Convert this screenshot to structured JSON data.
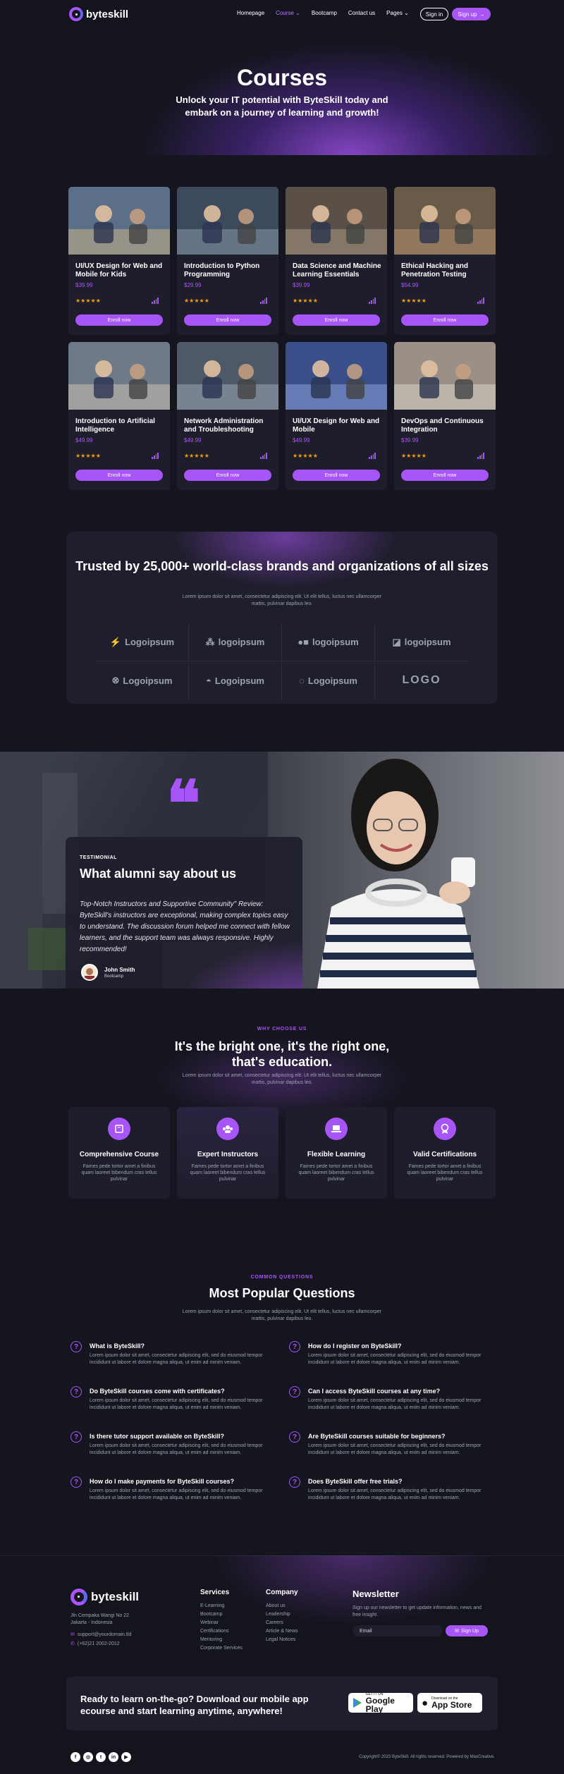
{
  "header": {
    "logo": "byteskill",
    "nav": [
      {
        "label": "Homepage",
        "active": false,
        "dropdown": false
      },
      {
        "label": "Course",
        "active": true,
        "dropdown": true
      },
      {
        "label": "Bootcamp",
        "active": false,
        "dropdown": false
      },
      {
        "label": "Contact us",
        "active": false,
        "dropdown": false
      },
      {
        "label": "Pages",
        "active": false,
        "dropdown": true
      }
    ],
    "signin": "Sign in",
    "signup": "Sign up"
  },
  "hero": {
    "title": "Courses",
    "subtitle": "Unlock your IT potential with ByteSkill today and embark on a journey of learning and growth!"
  },
  "courses": [
    {
      "title": "UI/UX Design for Web and Mobile for Kids",
      "price": "$39.99",
      "stars": "★★★★★",
      "button": "Enroll now"
    },
    {
      "title": "Introduction to Python Programming",
      "price": "$29.99",
      "stars": "★★★★★",
      "button": "Enroll now"
    },
    {
      "title": "Data Science and Machine Learning Essentials",
      "price": "$39.99",
      "stars": "★★★★★",
      "button": "Enroll now"
    },
    {
      "title": "Ethical Hacking and Penetration Testing",
      "price": "$54.99",
      "stars": "★★★★★",
      "button": "Enroll now"
    },
    {
      "title": "Introduction to Artificial Intelligence",
      "price": "$49.99",
      "stars": "★★★★★",
      "button": "Enroll now"
    },
    {
      "title": "Network Administration and Troubleshooting",
      "price": "$49.99",
      "stars": "★★★★★",
      "button": "Enroll now"
    },
    {
      "title": "UI/UX Design for Web and Mobile",
      "price": "$49.99",
      "stars": "★★★★★",
      "button": "Enroll now"
    },
    {
      "title": "DevOps and Continuous Integration",
      "price": "$39.99",
      "stars": "★★★★★",
      "button": "Enroll now"
    }
  ],
  "trusted": {
    "title": "Trusted by 25,000+ world-class brands and organizations of all sizes",
    "text": "Lorem ipsum dolor sit amet, consectetur adipiscing elit. Ut elit tellus, luctus nec ullamcorper mattis, pulvinar dapibus leo.",
    "logos": [
      "Logoipsum",
      "logoipsum",
      "logoipsum",
      "logoipsum",
      "Logoipsum",
      "Logoipsum",
      "Logoipsum",
      "LOGO"
    ]
  },
  "testimonial": {
    "label": "TESTIMONIAL",
    "title": "What alumni say about us",
    "text": "Top-Notch Instructors and Supportive Community\" Review: ByteSkill's instructors are exceptional, making complex topics easy to understand. The discussion forum helped me connect with fellow learners, and the support team was always responsive. Highly recommended!",
    "name": "John Smith",
    "role": "Bootcamp"
  },
  "why": {
    "label": "WHY CHOOSE US",
    "title": "It's the bright one, it's the right one, that's education.",
    "text": "Lorem ipsum dolor sit amet, consectetur adipiscing elit. Ut elit tellus, luctus nec ullamcorper mattis, pulvinar dapibus leo.",
    "features": [
      {
        "title": "Comprehensive Course",
        "text": "Fames pede tortor amet a finibus quam laoreet bibendum cras tellus pulvinar"
      },
      {
        "title": "Expert Instructors",
        "text": "Fames pede tortor amet a finibus quam laoreet bibendum cras tellus pulvinar"
      },
      {
        "title": "Flexible Learning",
        "text": "Fames pede tortor amet a finibus quam laoreet bibendum cras tellus pulvinar"
      },
      {
        "title": "Valid Certifications",
        "text": "Fames pede tortor amet a finibus quam laoreet bibendum cras tellus pulvinar"
      }
    ]
  },
  "faq": {
    "label": "COMMON QUESTIONS",
    "title": "Most Popular Questions",
    "text": "Lorem ipsum dolor sit amet, consectetur adipiscing elit. Ut elit tellus, luctus nec ullamcorper mattis, pulvinar dapibus leo.",
    "answer": "Lorem ipsum dolor sit amet, consectetur adipiscing elit, sed do eiusmod tempor incididunt ut labore et dolore magna aliqua, ut enim ad minim veniam.",
    "items": [
      "What is ByteSkill?",
      "How do I register on ByteSkill?",
      "Do ByteSkill courses come with certificates?",
      "Can I access ByteSkill courses at any time?",
      "Is there tutor support available on ByteSkill?",
      "Are ByteSkill courses suitable for beginners?",
      "How do I make payments for ByteSkill courses?",
      "Does ByteSkill offer free trials?"
    ]
  },
  "footer": {
    "logo": "byteskill",
    "address_line1": "Jln Cempaka Wangi No 22",
    "address_line2": "Jakarta - Indonesia",
    "email": "support@yourdomain.tld",
    "phone": "(+62)21 2002-2012",
    "services_title": "Services",
    "services": [
      "E-Learning",
      "Bootcamp",
      "Webinar",
      "Certifications",
      "Mentoring",
      "Corporate Services"
    ],
    "company_title": "Company",
    "company": [
      "About us",
      "Leadership",
      "Careers",
      "Article & News",
      "Legal Notices"
    ],
    "newsletter_title": "Newsletter",
    "newsletter_text": "Sign up our newsletter to get update information, news and free insight.",
    "email_placeholder": "Email",
    "signup_button": "Sign Up",
    "app_text": "Ready to learn on-the-go? Download our mobile app ecourse and start learning anytime, anywhere!",
    "google_small": "GET IT ON",
    "google_big": "Google Play",
    "apple_small": "Download on the",
    "apple_big": "App Store",
    "socials": [
      "f",
      "◎",
      "t",
      "in",
      "▶"
    ],
    "copyright": "Copyright© 2023 ByteSkill. All rights reserved. Powered by MaxCreative."
  },
  "colors": {
    "accent": "#a855f7",
    "background": "#15151f",
    "card": "#1e1d2b"
  }
}
